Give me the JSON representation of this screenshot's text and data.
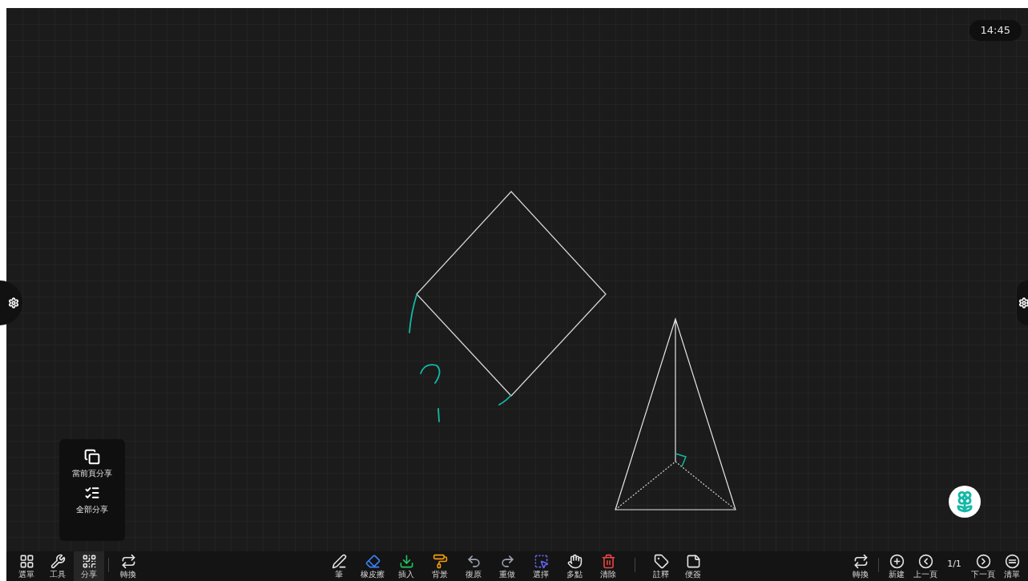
{
  "clock": "14:45",
  "share_menu": [
    {
      "label": "當前頁分享"
    },
    {
      "label": "全部分享"
    }
  ],
  "left_tools": [
    {
      "label": "選單"
    },
    {
      "label": "工具"
    },
    {
      "label": "分享",
      "selected": true
    },
    {
      "label": "轉換"
    }
  ],
  "center_tools": [
    {
      "label": "筆"
    },
    {
      "label": "橡皮擦"
    },
    {
      "label": "插入"
    },
    {
      "label": "背景"
    },
    {
      "label": "復原"
    },
    {
      "label": "重做"
    },
    {
      "label": "選擇"
    },
    {
      "label": "多點"
    },
    {
      "label": "清除"
    }
  ],
  "extra_tools": [
    {
      "label": "註釋"
    },
    {
      "label": "便簽"
    }
  ],
  "right_tools": [
    {
      "kind": "button",
      "label": "轉換"
    },
    {
      "kind": "button",
      "label": "新建"
    },
    {
      "kind": "button",
      "label": "上一頁"
    },
    {
      "kind": "indicator",
      "label": "1/1"
    },
    {
      "kind": "button",
      "label": "下一頁"
    },
    {
      "kind": "button",
      "label": "清單"
    }
  ]
}
